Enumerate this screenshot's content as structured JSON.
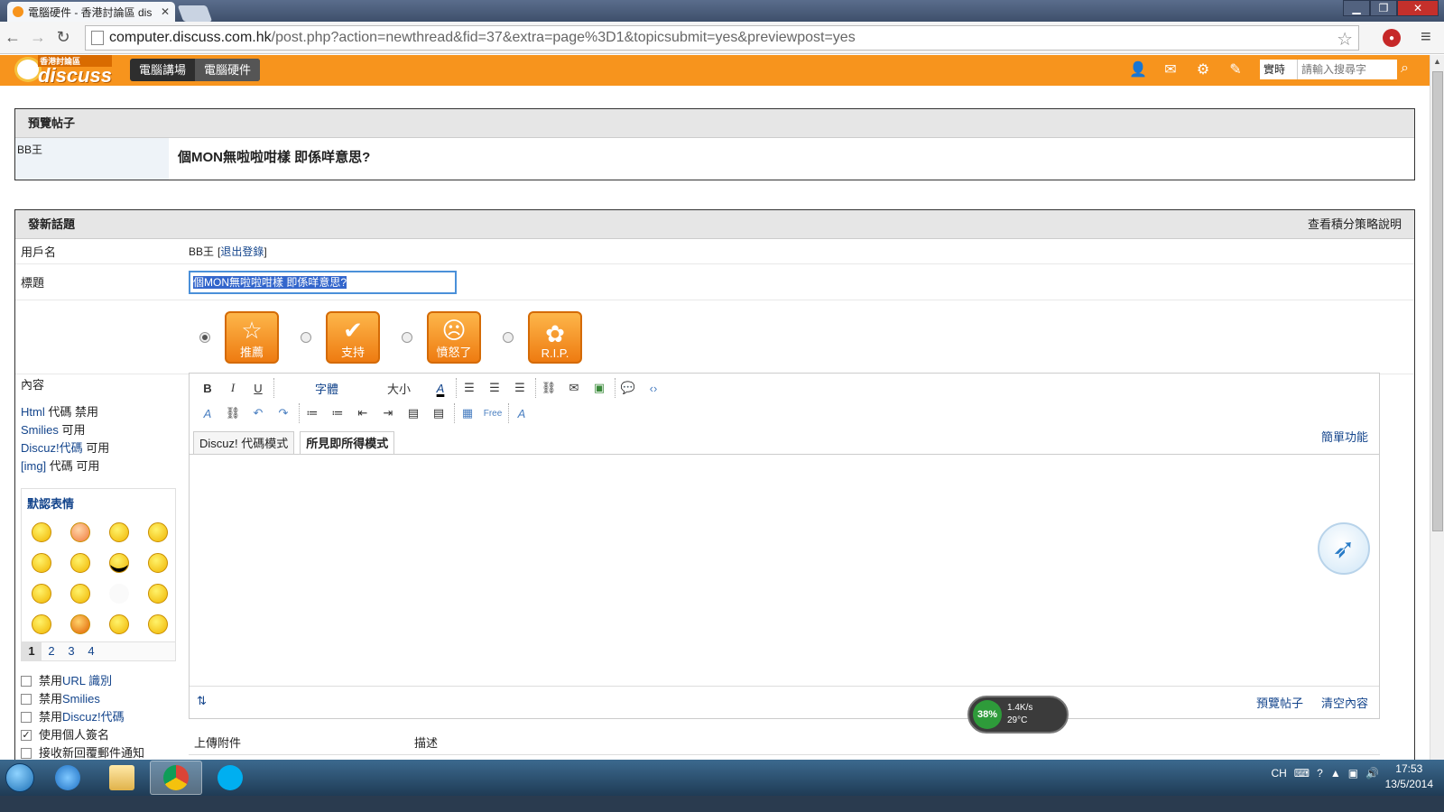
{
  "browser": {
    "tab_title": "電腦硬件 - 香港討論區 dis",
    "url_host": "computer.discuss.com.hk",
    "url_path": "/post.php?action=newthread&fid=37&extra=page%3D1&topicsubmit=yes&previewpost=yes"
  },
  "site": {
    "logo_small": "香港討論區",
    "logo_big": "discuss",
    "nav": [
      "電腦講場",
      "電腦硬件"
    ],
    "search_scope": "實時",
    "search_placeholder": "請輸入搜尋字"
  },
  "preview": {
    "heading": "預覽帖子",
    "author": "BB王",
    "subject": "個MON無啦啦咁樣 即係咩意思?"
  },
  "newthread": {
    "heading": "發新話題",
    "rules_link": "查看積分策略說明",
    "username_label": "用戶名",
    "username": "BB王",
    "logout_link": "退出登錄",
    "subject_label": "標題",
    "subject_value": "個MON無啦啦咁樣 即係咩意思?",
    "icons": [
      {
        "label": "推薦",
        "selected": true
      },
      {
        "label": "支持",
        "selected": false
      },
      {
        "label": "憤怒了",
        "selected": false
      },
      {
        "label": "R.I.P.",
        "selected": false
      }
    ],
    "content_label": "內容",
    "code_status": [
      {
        "name": "Html",
        "suffix": " 代碼 禁用"
      },
      {
        "name": "Smilies",
        "suffix": " 可用"
      },
      {
        "name": "Discuz!代碼",
        "suffix": " 可用"
      },
      {
        "name": "[img]",
        "suffix": " 代碼 可用"
      }
    ],
    "smilies_title": "默認表情",
    "smilies_pages": [
      "1",
      "2",
      "3",
      "4"
    ],
    "options": [
      {
        "prefix": "禁用 ",
        "link": "URL 識別",
        "checked": false
      },
      {
        "prefix": "禁用 ",
        "link": "Smilies",
        "checked": false
      },
      {
        "prefix": "禁用 ",
        "link": "Discuz!代碼",
        "checked": false
      },
      {
        "prefix": "使用個人簽名",
        "link": "",
        "checked": true
      },
      {
        "prefix": "接收新回覆郵件通知",
        "link": "",
        "checked": false
      }
    ]
  },
  "editor": {
    "font_label": "字體",
    "size_label": "大小",
    "mode_discuz": "Discuz! 代碼模式",
    "mode_wysiwyg": "所見即所得模式",
    "simple_link": "簡單功能",
    "preview_btn": "預覽帖子",
    "clear_btn": "清空內容",
    "attach_label": "上傳附件",
    "desc_label": "描述"
  },
  "speed_widget": {
    "percent": "38%",
    "rate": "1.4K/s",
    "temp": "29°C"
  },
  "taskbar": {
    "lang": "CH",
    "time": "17:53",
    "date": "13/5/2014"
  }
}
